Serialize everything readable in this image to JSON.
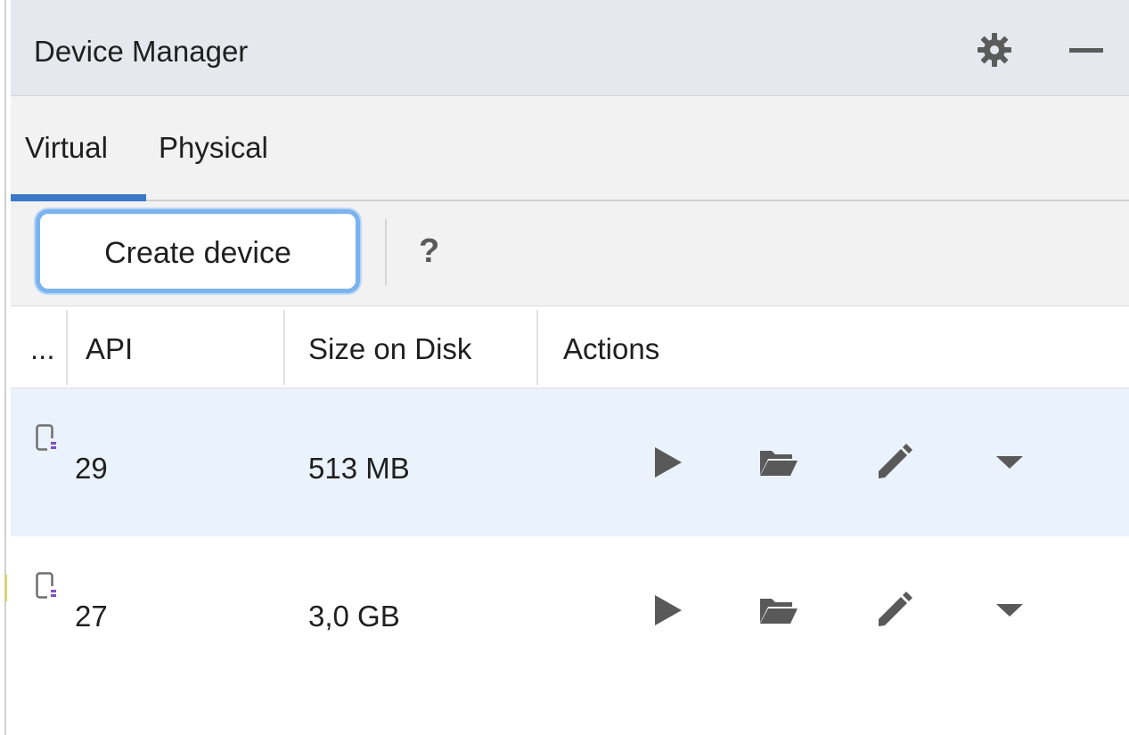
{
  "window": {
    "title": "Device Manager",
    "settings_icon": "gear-icon",
    "minimize_icon": "minimize-icon"
  },
  "tabs": [
    {
      "label": "Virtual",
      "selected": true
    },
    {
      "label": "Physical",
      "selected": false
    }
  ],
  "toolbar": {
    "create_label": "Create device",
    "help_label": "?"
  },
  "table": {
    "columns": [
      "...",
      "API",
      "Size on Disk",
      "Actions"
    ],
    "rows": [
      {
        "device_icon": "virtual-device-icon",
        "api": "29",
        "size": "513 MB",
        "selected": true
      },
      {
        "device_icon": "virtual-device-icon",
        "api": "27",
        "size": "3,0 GB",
        "selected": false
      }
    ],
    "actions": [
      "play-icon",
      "folder-icon",
      "pencil-icon",
      "dropdown-arrow-icon"
    ]
  },
  "colors": {
    "title_bg": "#e6e8ee",
    "tab_bg": "#f2f2f2",
    "accent": "#3b78c8",
    "selected_row": "#eaf2fb",
    "icon_gray": "#595959",
    "device_badge": "#7b4fc9"
  }
}
